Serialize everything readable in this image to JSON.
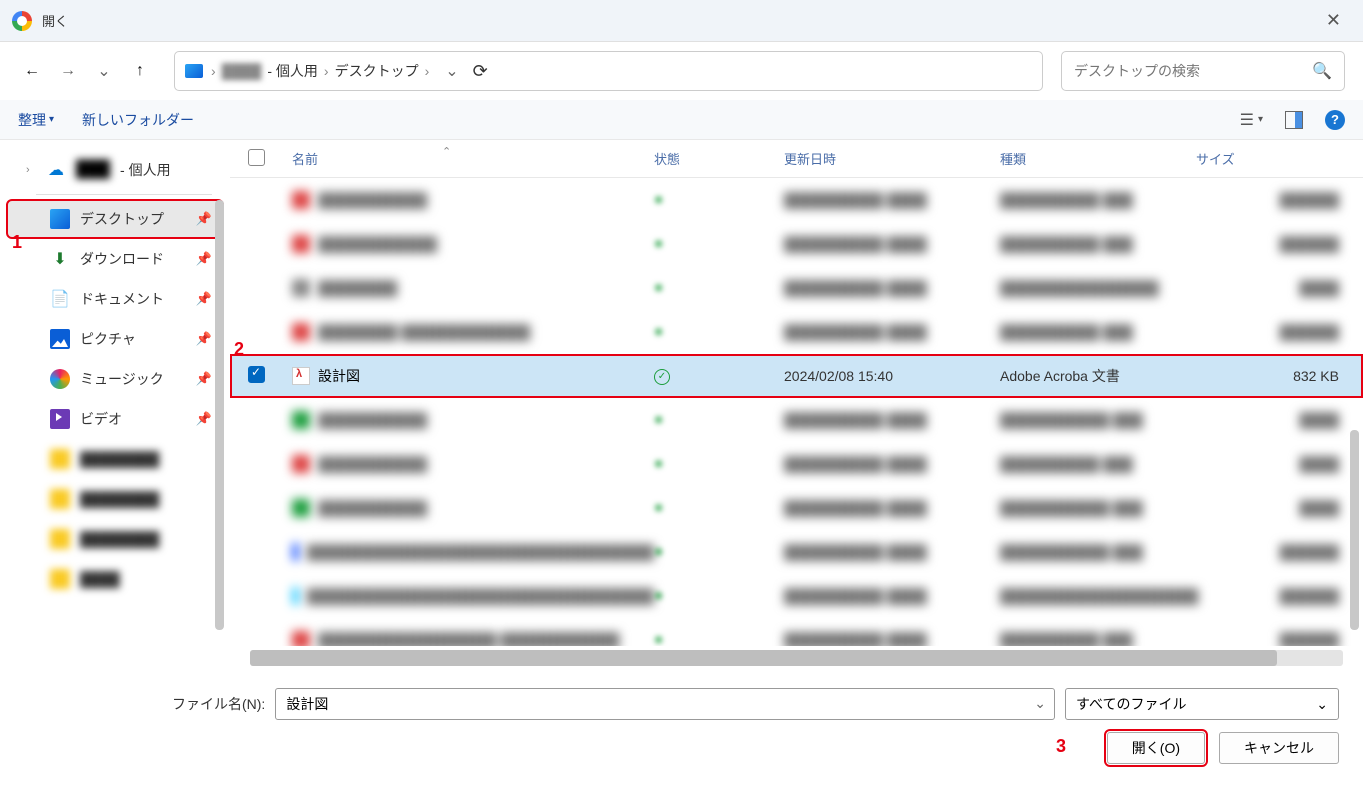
{
  "titlebar": {
    "title": "開く"
  },
  "nav": {
    "breadcrumb_personal": "- 個人用",
    "breadcrumb_desktop": "デスクトップ"
  },
  "search": {
    "placeholder": "デスクトップの検索"
  },
  "toolbar": {
    "organize": "整理",
    "new_folder": "新しいフォルダー"
  },
  "sidebar": {
    "personal": "- 個人用",
    "desktop": "デスクトップ",
    "downloads": "ダウンロード",
    "documents": "ドキュメント",
    "pictures": "ピクチャ",
    "music": "ミュージック",
    "videos": "ビデオ"
  },
  "columns": {
    "name": "名前",
    "status": "状態",
    "modified": "更新日時",
    "type": "種類",
    "size": "サイズ"
  },
  "selected_file": {
    "name": "設計図",
    "status": "✓",
    "modified": "2024/02/08 15:40",
    "type": "Adobe Acroba 文書",
    "size": "832 KB"
  },
  "footer": {
    "filename_label": "ファイル名(N):",
    "filename_value": "設計図",
    "filetype": "すべてのファイル",
    "open": "開く(O)",
    "cancel": "キャンセル"
  },
  "annotations": {
    "n1": "1",
    "n2": "2",
    "n3": "3"
  }
}
